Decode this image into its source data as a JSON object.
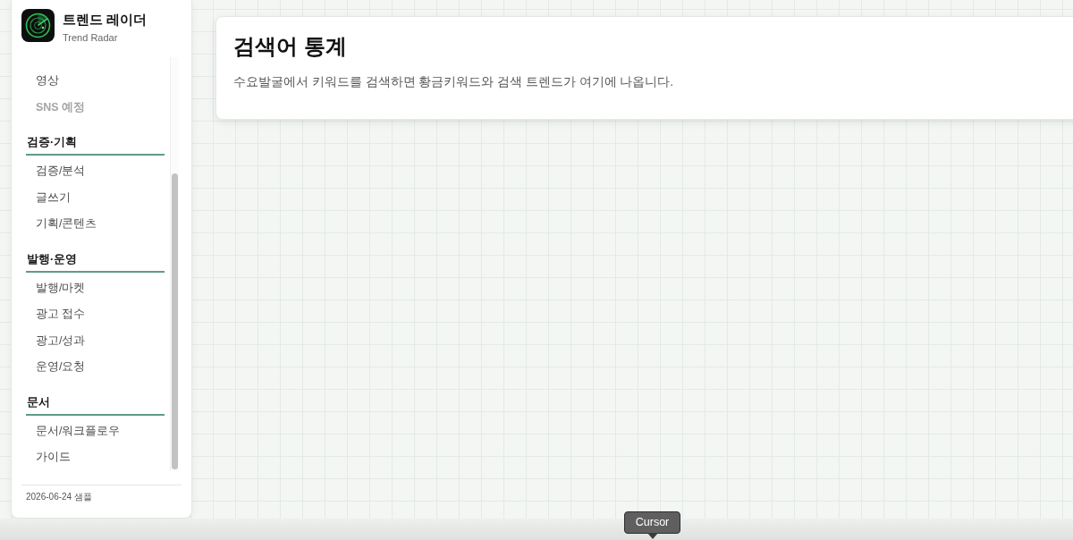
{
  "app": {
    "title": "트렌드 레이더",
    "subtitle": "Trend Radar"
  },
  "sidebar": {
    "groups": [
      {
        "items": [
          {
            "label": "영상",
            "disabled": false
          },
          {
            "label": "SNS 예정",
            "disabled": true
          }
        ]
      },
      {
        "heading": "검증·기획",
        "items": [
          {
            "label": "검증/분석",
            "disabled": false
          },
          {
            "label": "글쓰기",
            "disabled": false
          },
          {
            "label": "기획/콘텐츠",
            "disabled": false
          }
        ]
      },
      {
        "heading": "발행·운영",
        "items": [
          {
            "label": "발행/마켓",
            "disabled": false
          },
          {
            "label": "광고 접수",
            "disabled": false
          },
          {
            "label": "광고/성과",
            "disabled": false
          },
          {
            "label": "운영/요청",
            "disabled": false
          }
        ]
      },
      {
        "heading": "문서",
        "items": [
          {
            "label": "문서/워크플로우",
            "disabled": false
          },
          {
            "label": "가이드",
            "disabled": false
          }
        ]
      }
    ],
    "footer": "2026-06-24 샘플"
  },
  "page": {
    "title": "검색어 통계",
    "description": "수요발굴에서 키워드를 검색하면 황금키워드와 검색 트렌드가 여기에 나옵니다."
  },
  "cursor_tooltip": {
    "label": "Cursor"
  }
}
